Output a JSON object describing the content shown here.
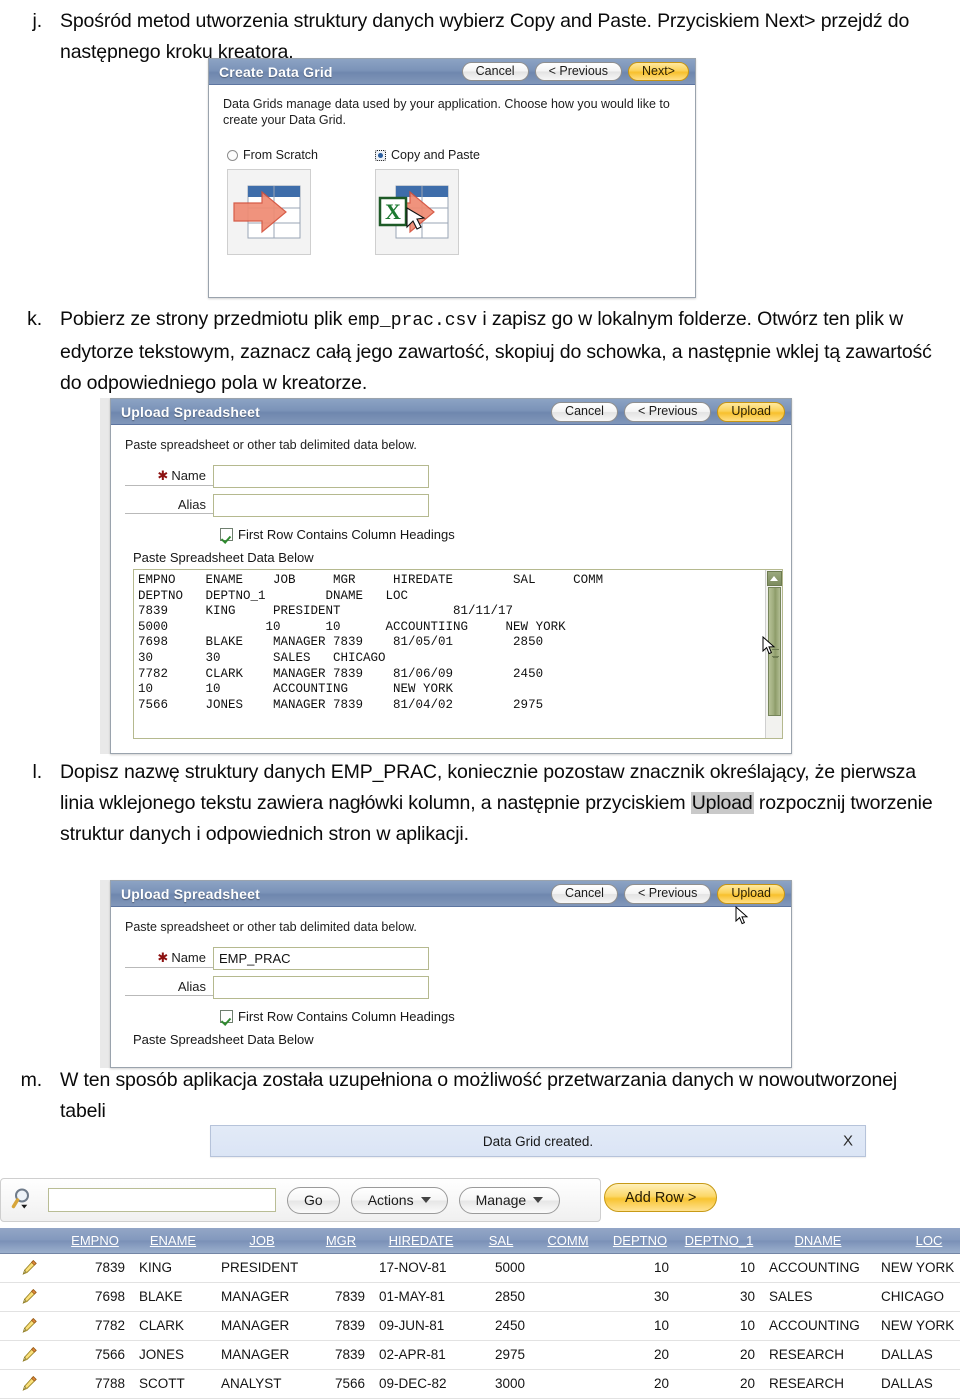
{
  "document": {
    "items": [
      {
        "marker": "j.",
        "text_before": "Spośród metod utworzenia struktury danych wybierz Copy and Paste. Przyciskiem Next> przejdź do następnego kroku kreatora."
      },
      {
        "marker": "k.",
        "seg1": "Pobierz ze strony przedmiotu plik ",
        "mono": "emp_prac.csv",
        "seg2": " i zapisz go w lokalnym folderze. Otwórz ten plik w edytorze tekstowym, zaznacz całą jego zawartość, skopiuj do schowka, a następnie wklej tą zawartość do odpowiedniego pola w kreatorze."
      },
      {
        "marker": "l.",
        "seg1": "Dopisz nazwę struktury danych EMP_PRAC, koniecznie pozostaw znacznik określający, że pierwsza linia wklejonego tekstu zawiera nagłówki kolumn, a następnie przyciskiem ",
        "highlight": "Upload",
        "seg2": " rozpocznij tworzenie struktur danych i odpowiednich stron w aplikacji."
      },
      {
        "marker": "m.",
        "text": "W ten sposób aplikacja została uzupełniona o możliwość przetwarzania danych w nowoutworzonej tabeli"
      }
    ]
  },
  "create_data_grid_dialog": {
    "title": "Create Data Grid",
    "buttons": {
      "cancel": "Cancel",
      "previous": "< Previous",
      "next": "Next>"
    },
    "description": "Data Grids manage data used by your application. Choose how you would like to create your Data Grid.",
    "options": [
      {
        "label": "From Scratch",
        "selected": false,
        "icon": "table-arrow-icon"
      },
      {
        "label": "Copy and Paste",
        "selected": true,
        "icon": "excel-table-arrow-icon"
      }
    ]
  },
  "upload_spreadsheet_empty": {
    "title": "Upload Spreadsheet",
    "buttons": {
      "cancel": "Cancel",
      "previous": "< Previous",
      "upload": "Upload"
    },
    "instruction": "Paste spreadsheet or other tab delimited data below.",
    "name_label": "Name",
    "name_value": "",
    "alias_label": "Alias",
    "alias_value": "",
    "checkbox_label": "First Row Contains Column Headings",
    "checkbox_checked": true,
    "paste_label": "Paste Spreadsheet Data Below",
    "pasted_data": "EMPNO    ENAME    JOB     MGR     HIREDATE        SAL     COMM\nDEPTNO   DEPTNO_1        DNAME   LOC\n7839     KING     PRESIDENT               81/11/17\n5000             10      10      ACCOUNTIING     NEW YORK\n7698     BLAKE    MANAGER 7839    81/05/01        2850\n30       30       SALES   CHICAGO\n7782     CLARK    MANAGER 7839    81/06/09        2450\n10       10       ACCOUNTING      NEW YORK\n7566     JONES    MANAGER 7839    81/04/02        2975"
  },
  "upload_spreadsheet_filled": {
    "title": "Upload Spreadsheet",
    "buttons": {
      "cancel": "Cancel",
      "previous": "< Previous",
      "upload": "Upload"
    },
    "instruction": "Paste spreadsheet or other tab delimited data below.",
    "name_label": "Name",
    "name_value": "EMP_PRAC",
    "alias_label": "Alias",
    "alias_value": "",
    "checkbox_label": "First Row Contains Column Headings",
    "checkbox_checked": true,
    "paste_label": "Paste Spreadsheet Data Below"
  },
  "message": {
    "text": "Data Grid created.",
    "close_label": "X"
  },
  "report": {
    "search_value": "",
    "go_label": "Go",
    "actions_label": "Actions",
    "manage_label": "Manage",
    "add_row_label": "Add Row >",
    "columns": [
      "EMPNO",
      "ENAME",
      "JOB",
      "MGR",
      "HIREDATE",
      "SAL",
      "COMM",
      "DEPTNO",
      "DEPTNO_1",
      "DNAME",
      "LOC"
    ],
    "column_header_deptno1_display": "DEPTNO_1",
    "rows": [
      {
        "EMPNO": "7839",
        "ENAME": "KING",
        "JOB": "PRESIDENT",
        "MGR": "",
        "HIREDATE": "17-NOV-81",
        "SAL": "5000",
        "COMM": "",
        "DEPTNO": "10",
        "DEPTNO_1": "10",
        "DNAME": "ACCOUNTING",
        "LOC": "NEW YORK"
      },
      {
        "EMPNO": "7698",
        "ENAME": "BLAKE",
        "JOB": "MANAGER",
        "MGR": "7839",
        "HIREDATE": "01-MAY-81",
        "SAL": "2850",
        "COMM": "",
        "DEPTNO": "30",
        "DEPTNO_1": "30",
        "DNAME": "SALES",
        "LOC": "CHICAGO"
      },
      {
        "EMPNO": "7782",
        "ENAME": "CLARK",
        "JOB": "MANAGER",
        "MGR": "7839",
        "HIREDATE": "09-JUN-81",
        "SAL": "2450",
        "COMM": "",
        "DEPTNO": "10",
        "DEPTNO_1": "10",
        "DNAME": "ACCOUNTING",
        "LOC": "NEW YORK"
      },
      {
        "EMPNO": "7566",
        "ENAME": "JONES",
        "JOB": "MANAGER",
        "MGR": "7839",
        "HIREDATE": "02-APR-81",
        "SAL": "2975",
        "COMM": "",
        "DEPTNO": "20",
        "DEPTNO_1": "20",
        "DNAME": "RESEARCH",
        "LOC": "DALLAS"
      },
      {
        "EMPNO": "7788",
        "ENAME": "SCOTT",
        "JOB": "ANALYST",
        "MGR": "7566",
        "HIREDATE": "09-DEC-82",
        "SAL": "3000",
        "COMM": "",
        "DEPTNO": "20",
        "DEPTNO_1": "20",
        "DNAME": "RESEARCH",
        "LOC": "DALLAS"
      }
    ]
  },
  "colors": {
    "dialog_header": "#7f96bb",
    "gold_button": "#f8c431",
    "message_bg": "#dfe8f6",
    "field_border": "#b5b98f",
    "scrollbar": "#9caa7a"
  }
}
